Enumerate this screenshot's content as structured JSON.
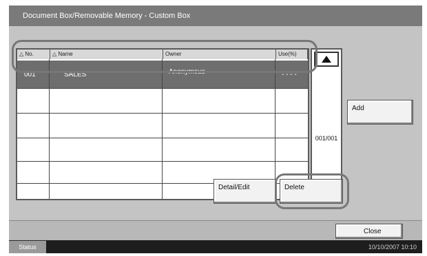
{
  "title": "Document Box/Removable Memory - Custom Box",
  "table": {
    "headers": [
      "No.",
      "Name",
      "Owner",
      "Use(%)"
    ],
    "rows": [
      {
        "no": "001",
        "name": "SALES",
        "owner": "Anonymous",
        "use": "- - - -"
      }
    ]
  },
  "pagination": {
    "page": "001/001"
  },
  "buttons": {
    "add": "Add",
    "detail_edit": "Detail/Edit",
    "delete": "Delete",
    "close": "Close"
  },
  "status": {
    "label": "Status",
    "datetime": "10/10/2007   10:10"
  }
}
